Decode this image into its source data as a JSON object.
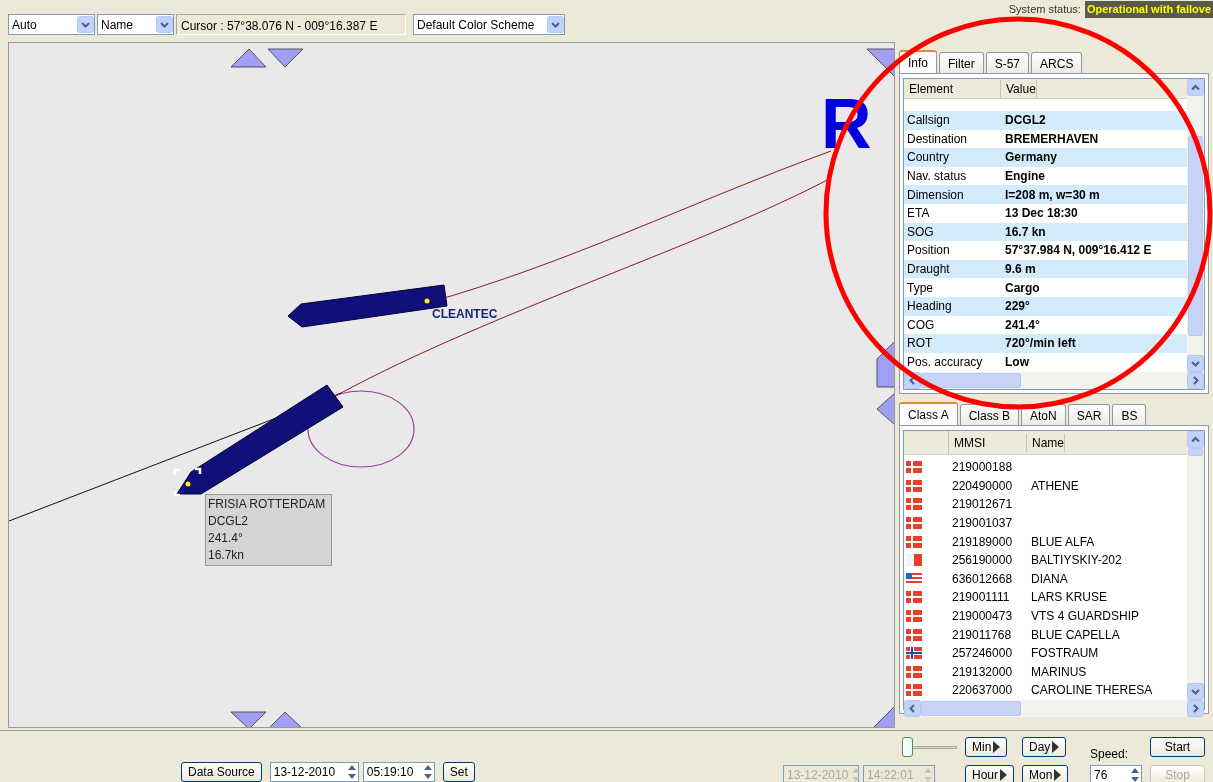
{
  "toolbar": {
    "mode_select": "Auto",
    "label_select": "Name",
    "cursor": "Cursor : 57°38.076 N - 009°16.387 E",
    "color_scheme": "Default Color Scheme",
    "status_label": "System status:",
    "status_value": "Operational with failove"
  },
  "map": {
    "corner_letter": "R",
    "ships": [
      {
        "kind": "labeled",
        "name": "CLEANTEC"
      },
      {
        "kind": "selected"
      }
    ],
    "tooltip": [
      "FRISIA ROTTERDAM",
      "DCGL2",
      "241.4°",
      "16.7kn"
    ]
  },
  "info_tabs": [
    {
      "label": "Info",
      "selected": true
    },
    {
      "label": "Filter",
      "selected": false
    },
    {
      "label": "S-57",
      "selected": false
    },
    {
      "label": "ARCS",
      "selected": false
    }
  ],
  "info_table": {
    "columns": [
      "Element",
      "Value"
    ],
    "rows": [
      {
        "element": "Callsign",
        "value": "DCGL2"
      },
      {
        "element": "Destination",
        "value": "BREMERHAVEN"
      },
      {
        "element": "Country",
        "value": "Germany"
      },
      {
        "element": "Nav. status",
        "value": "Engine"
      },
      {
        "element": "Dimension",
        "value": "l=208 m, w=30 m"
      },
      {
        "element": "ETA",
        "value": "13 Dec 18:30"
      },
      {
        "element": "SOG",
        "value": "16.7 kn"
      },
      {
        "element": "Position",
        "value": "57°37.984 N, 009°16.412 E"
      },
      {
        "element": "Draught",
        "value": "9.6 m"
      },
      {
        "element": "Type",
        "value": "Cargo"
      },
      {
        "element": "Heading",
        "value": "229°"
      },
      {
        "element": "COG",
        "value": "241.4°"
      },
      {
        "element": "ROT",
        "value": "720°/min left"
      },
      {
        "element": "Pos. accuracy",
        "value": "Low"
      }
    ]
  },
  "list_tabs": [
    {
      "label": "Class A",
      "selected": true
    },
    {
      "label": "Class B",
      "selected": false
    },
    {
      "label": "AtoN",
      "selected": false
    },
    {
      "label": "SAR",
      "selected": false
    },
    {
      "label": "BS",
      "selected": false
    }
  ],
  "vessel_table": {
    "columns": [
      "MMSI",
      "Name"
    ],
    "rows": [
      {
        "kind": "denmark",
        "mmsi": "219000188",
        "name": ""
      },
      {
        "kind": "denmark",
        "mmsi": "220490000",
        "name": "ATHENE"
      },
      {
        "kind": "denmark",
        "mmsi": "219012671",
        "name": ""
      },
      {
        "kind": "denmark",
        "mmsi": "219001037",
        "name": ""
      },
      {
        "kind": "denmark",
        "mmsi": "219189000",
        "name": "BLUE ALFA"
      },
      {
        "kind": "malta",
        "mmsi": "256190000",
        "name": "BALTIYSKIY-202"
      },
      {
        "kind": "liberia",
        "mmsi": "636012668",
        "name": "DIANA"
      },
      {
        "kind": "denmark",
        "mmsi": "219001111",
        "name": "LARS KRUSE"
      },
      {
        "kind": "denmark",
        "mmsi": "219000473",
        "name": "VTS 4 GUARDSHIP"
      },
      {
        "kind": "denmark",
        "mmsi": "219011768",
        "name": "BLUE CAPELLA"
      },
      {
        "kind": "norway",
        "mmsi": "257246000",
        "name": "FOSTRAUM"
      },
      {
        "kind": "denmark",
        "mmsi": "219132000",
        "name": "MARINUS"
      },
      {
        "kind": "denmark",
        "mmsi": "220637000",
        "name": "CAROLINE THERESA"
      }
    ]
  },
  "playback": {
    "data_source": "Data Source",
    "date": "13-12-2010",
    "time": "05:19:10",
    "set": "Set",
    "end_date": "13-12-2010",
    "end_time": "14:22:01",
    "end_disabled": true,
    "slider": {
      "level": 0
    },
    "step_buttons": [
      [
        "Min",
        "Hour"
      ],
      [
        "Day",
        "Mon"
      ]
    ],
    "speed_label": "Speed:",
    "speed": "76",
    "start": "Start",
    "stop": "Stop",
    "stop_disabled": true
  }
}
